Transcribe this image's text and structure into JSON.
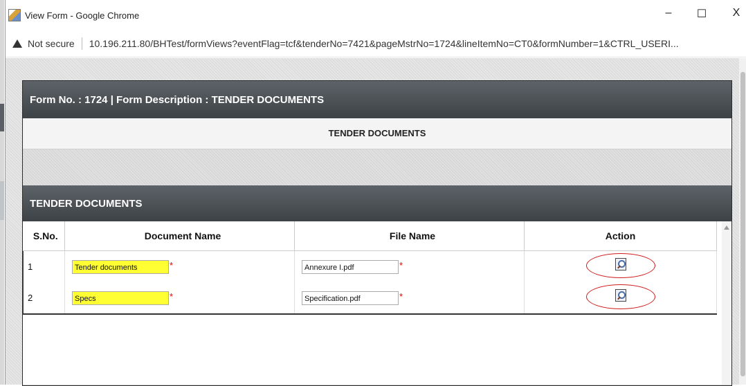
{
  "browser": {
    "title": "View Form - Google Chrome",
    "controls": {
      "minimize": "–",
      "maximize": "☐",
      "close": "X"
    },
    "security_label": "Not secure",
    "url": "10.196.211.80/BHTest/formViews?eventFlag=tcf&tenderNo=7421&pageMstrNo=1724&lineItemNo=CT0&formNumber=1&CTRL_USERI..."
  },
  "form": {
    "header": "Form No. : 1724 | Form Description : TENDER DOCUMENTS",
    "subheader": "TENDER DOCUMENTS",
    "section_title": "TENDER DOCUMENTS",
    "table": {
      "columns": [
        "S.No.",
        "Document Name",
        "File Name",
        "Action"
      ],
      "rows": [
        {
          "sno": "1",
          "document_name": "Tender documents",
          "file_name": "Annexure I.pdf"
        },
        {
          "sno": "2",
          "document_name": "Specs",
          "file_name": "Specification.pdf"
        }
      ],
      "required_marker": "*"
    }
  },
  "colors": {
    "header_dark": "#3d4246",
    "highlight_yellow": "#ffff33",
    "annotation_red": "#d01818"
  }
}
